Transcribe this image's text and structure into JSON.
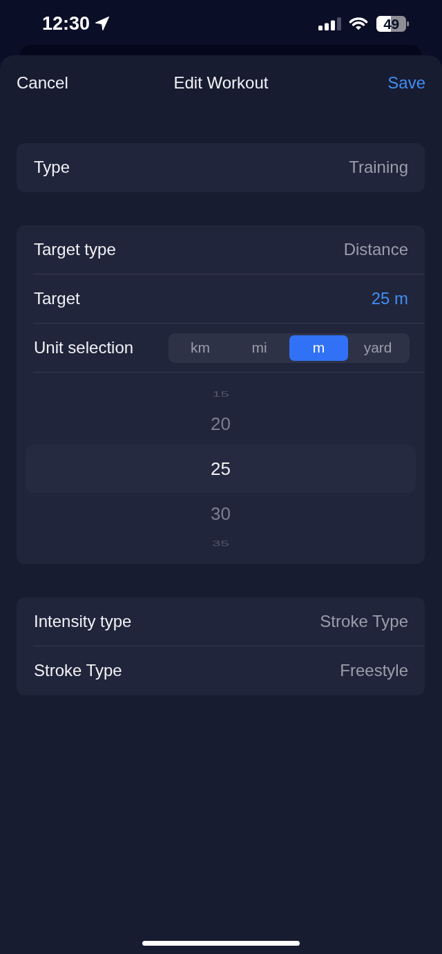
{
  "status_bar": {
    "time": "12:30",
    "battery": "49"
  },
  "nav_bar": {
    "cancel": "Cancel",
    "title": "Edit Workout",
    "save": "Save"
  },
  "sections": [
    {
      "rows": [
        {
          "kind": "value",
          "label": "Type",
          "value": "Training",
          "expanded": false
        }
      ]
    },
    {
      "rows": [
        {
          "kind": "value",
          "label": "Target type",
          "value": "Distance",
          "expanded": false
        },
        {
          "kind": "value",
          "label": "Target",
          "value": "25 m",
          "expanded": true
        },
        {
          "kind": "segmented",
          "label": "Unit selection",
          "options": [
            {
              "label": "km",
              "selected": false
            },
            {
              "label": "mi",
              "selected": false
            },
            {
              "label": "m",
              "selected": true
            },
            {
              "label": "yard",
              "selected": false
            }
          ]
        },
        {
          "kind": "picker",
          "items": [
            {
              "label": "15",
              "selected": false
            },
            {
              "label": "20",
              "selected": false
            },
            {
              "label": "25",
              "selected": true
            },
            {
              "label": "30",
              "selected": false
            },
            {
              "label": "35",
              "selected": false
            }
          ]
        }
      ]
    },
    {
      "rows": [
        {
          "kind": "value",
          "label": "Intensity type",
          "value": "Stroke Type",
          "expanded": false
        },
        {
          "kind": "value",
          "label": "Stroke Type",
          "value": "Freestyle",
          "expanded": false
        }
      ]
    }
  ]
}
